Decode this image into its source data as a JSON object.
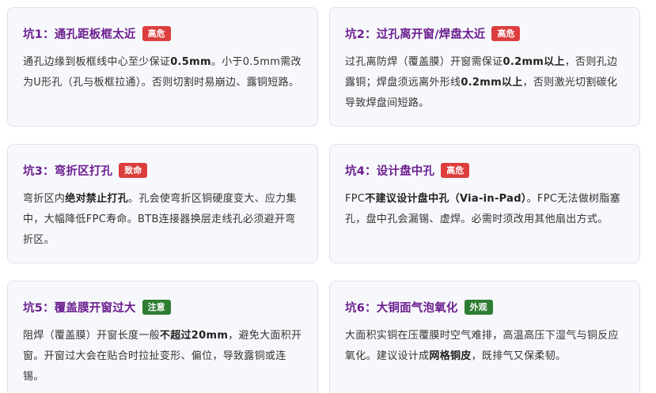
{
  "colors": {
    "title": "#6b1e8f",
    "badge_red": "#dc3d3d",
    "badge_green": "#2e7d32",
    "card_bg": "#f7f8fb",
    "card_border": "#dfe3ea",
    "text": "#333333"
  },
  "cards": [
    {
      "title": "坑1：通孔距板框太近",
      "badge": "高危",
      "badge_color": "#dc3d3d",
      "body": [
        {
          "t": "通孔边缘到板框线中心至少保证"
        },
        {
          "t": "0.5mm",
          "b": true
        },
        {
          "t": "。小于0.5mm需改为U形孔（孔与板框拉通）。否则切割时易崩边、露铜短路。"
        }
      ]
    },
    {
      "title": "坑2：过孔离开窗/焊盘太近",
      "badge": "高危",
      "badge_color": "#dc3d3d",
      "body": [
        {
          "t": "过孔离防焊（覆盖膜）开窗需保证"
        },
        {
          "t": "0.2mm以上",
          "b": true
        },
        {
          "t": "，否则孔边露铜；焊盘须远离外形线"
        },
        {
          "t": "0.2mm以上",
          "b": true
        },
        {
          "t": "，否则激光切割碳化导致焊盘间短路。"
        }
      ]
    },
    {
      "title": "坑3：弯折区打孔",
      "badge": "致命",
      "badge_color": "#dc3d3d",
      "body": [
        {
          "t": "弯折区内"
        },
        {
          "t": "绝对禁止打孔",
          "b": true
        },
        {
          "t": "。孔会使弯折区铜硬度变大、应力集中，大幅降低FPC寿命。BTB连接器换层走线孔必须避开弯折区。"
        }
      ]
    },
    {
      "title": "坑4：设计盘中孔",
      "badge": "高危",
      "badge_color": "#dc3d3d",
      "body": [
        {
          "t": "FPC"
        },
        {
          "t": "不建议设计盘中孔（Via-in-Pad）",
          "b": true
        },
        {
          "t": "。FPC无法做树脂塞孔，盘中孔会漏锡、虚焊。必需时须改用其他扇出方式。"
        }
      ]
    },
    {
      "title": "坑5：覆盖膜开窗过大",
      "badge": "注意",
      "badge_color": "#2e7d32",
      "body": [
        {
          "t": "阻焊（覆盖膜）开窗长度一般"
        },
        {
          "t": "不超过20mm",
          "b": true
        },
        {
          "t": "，避免大面积开窗。开窗过大会在贴合时拉扯变形、偏位，导致露铜或连锡。"
        }
      ]
    },
    {
      "title": "坑6：大铜面气泡氧化",
      "badge": "外观",
      "badge_color": "#2e7d32",
      "body": [
        {
          "t": "大面积实铜在压覆膜时空气难排，高温高压下湿气与铜反应氧化。建议设计成"
        },
        {
          "t": "网格铜皮",
          "b": true
        },
        {
          "t": "，既排气又保柔韧。"
        }
      ]
    }
  ]
}
